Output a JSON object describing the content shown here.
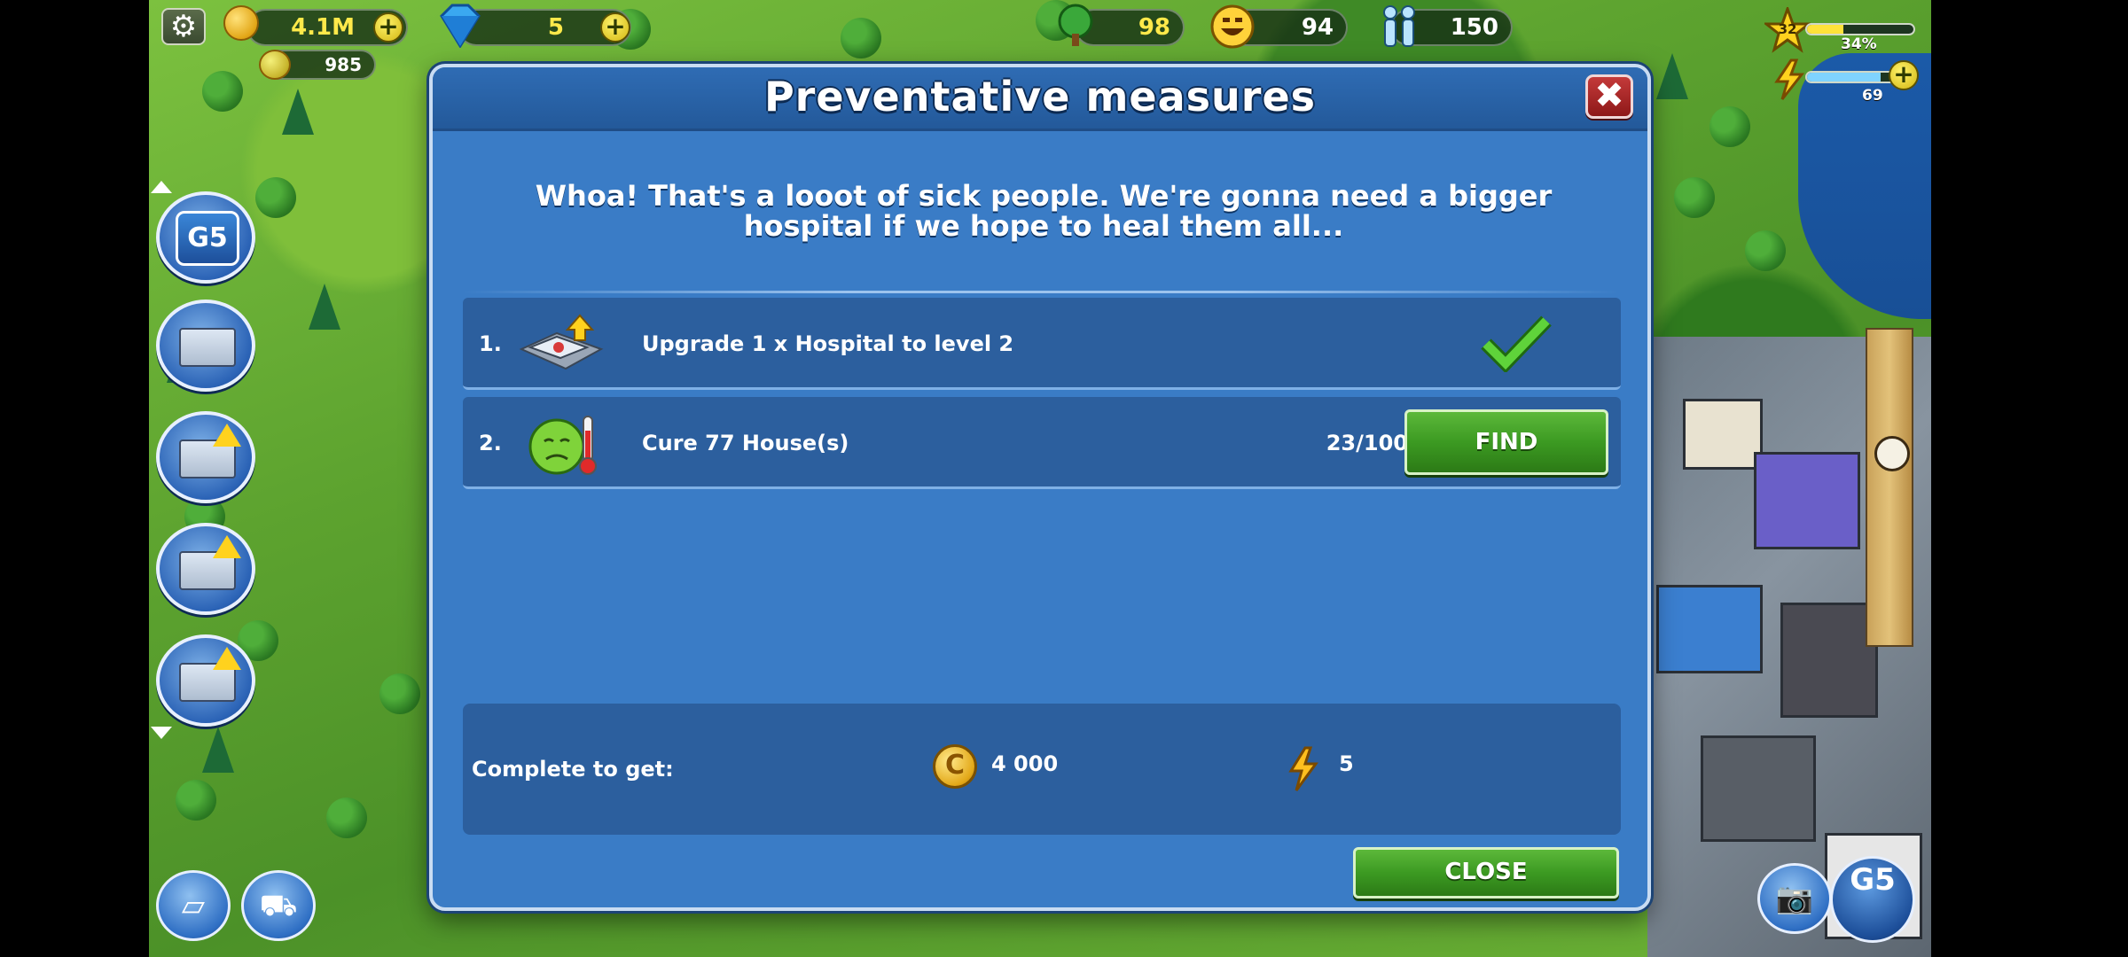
{
  "hud": {
    "coins": "4.1M",
    "gold": "985",
    "gems": "5",
    "eco": "98",
    "happiness": "94",
    "population": "150",
    "level": "32",
    "xp_percent": "34%",
    "energy": "69"
  },
  "modal": {
    "title": "Preventative measures",
    "close_x": "✖",
    "intro": "Whoa! That's a looot of sick people. We're gonna need a bigger hospital if we hope to heal them all...",
    "tasks": [
      {
        "number": "1.",
        "text": "Upgrade 1 x Hospital to level 2",
        "icon": "hospital-icon",
        "status": "complete"
      },
      {
        "number": "2.",
        "text": "Cure 77 House(s)",
        "icon": "sick-face-icon",
        "progress": "23/100",
        "action": "FIND"
      }
    ],
    "reward": {
      "label": "Complete to get:",
      "coin_amount": "4 000",
      "energy_amount": "5"
    },
    "close_label": "CLOSE"
  },
  "colors": {
    "modal_bg": "#3a7cc6",
    "row_bg": "#2c5f9e",
    "button_green": "#3c9a22",
    "close_red": "#b02a2a"
  }
}
